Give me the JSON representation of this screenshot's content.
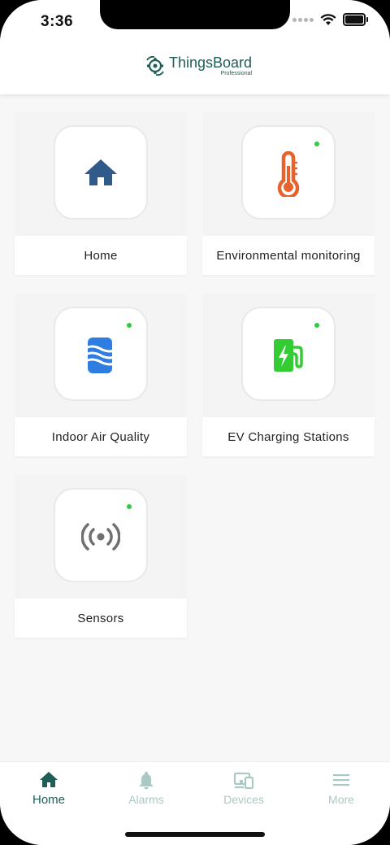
{
  "status_bar": {
    "time": "3:36"
  },
  "header": {
    "logo_title": "ThingsBoard",
    "logo_subtitle": "Professional"
  },
  "tiles": [
    {
      "label": "Home",
      "icon": "house-icon",
      "online": false
    },
    {
      "label": "Environmental monitoring",
      "icon": "thermometer-icon",
      "online": true
    },
    {
      "label": "Indoor Air Quality",
      "icon": "air-quality-icon",
      "online": true
    },
    {
      "label": "EV Charging Stations",
      "icon": "ev-charger-icon",
      "online": true
    },
    {
      "label": "Sensors",
      "icon": "sensor-signal-icon",
      "online": true
    }
  ],
  "bottom_nav": {
    "active": "Home",
    "items": [
      {
        "label": "Home",
        "icon": "home-icon"
      },
      {
        "label": "Alarms",
        "icon": "bell-icon"
      },
      {
        "label": "Devices",
        "icon": "devices-icon"
      },
      {
        "label": "More",
        "icon": "menu-icon"
      }
    ]
  },
  "colors": {
    "brand": "#1f5d57",
    "online_dot": "#2ecc40",
    "home_icon": "#2f5a8a",
    "thermometer": "#e8632b",
    "air_quality": "#2f7de0",
    "ev_charger": "#33cc33",
    "sensor": "#707070"
  }
}
